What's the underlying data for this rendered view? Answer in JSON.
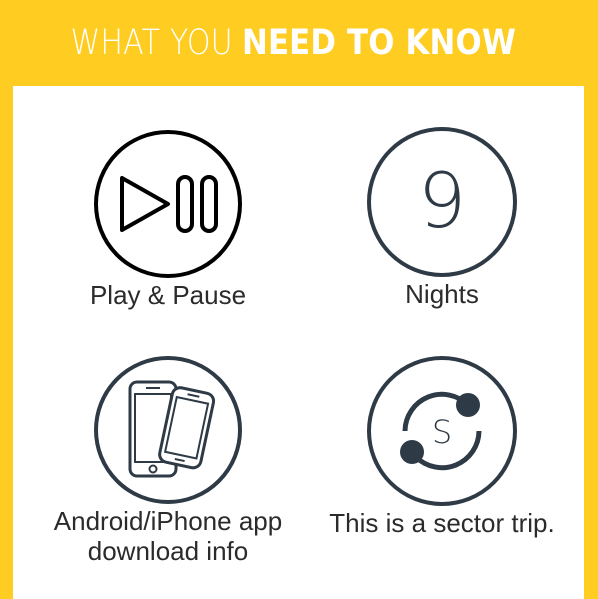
{
  "header": {
    "title_light": "WHAT YOU",
    "title_bold": "NEED TO KNOW"
  },
  "items": [
    {
      "icon": "play-pause-icon",
      "label": "Play & Pause"
    },
    {
      "icon": "number-nine-icon",
      "number": "9",
      "label": "Nights"
    },
    {
      "icon": "mobile-devices-icon",
      "label": "Android/iPhone app download info"
    },
    {
      "icon": "sector-trip-icon",
      "letter": "S",
      "label": "This is a sector trip."
    }
  ],
  "colors": {
    "frame": "#FFCC22",
    "icon_dark": "#2E3A45",
    "text": "#2B2B2B",
    "header_text": "#FFFFFF"
  }
}
